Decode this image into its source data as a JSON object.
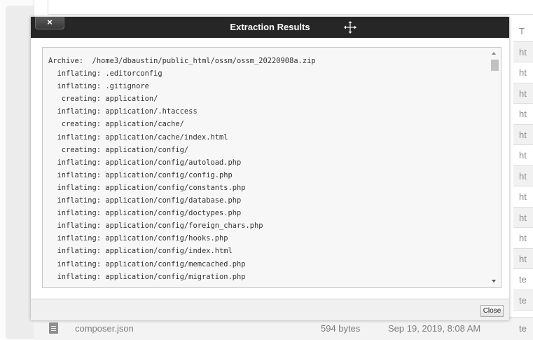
{
  "dialog": {
    "title": "Extraction Results",
    "close_x": "×",
    "close_button": "Close"
  },
  "log_lines": [
    "Archive:  /home3/dbaustin/public_html/ossm/ossm_20220908a.zip",
    "  inflating: .editorconfig",
    "  inflating: .gitignore",
    "   creating: application/",
    "  inflating: application/.htaccess",
    "   creating: application/cache/",
    "  inflating: application/cache/index.html",
    "   creating: application/config/",
    "  inflating: application/config/autoload.php",
    "  inflating: application/config/config.php",
    "  inflating: application/config/constants.php",
    "  inflating: application/config/database.php",
    "  inflating: application/config/doctypes.php",
    "  inflating: application/config/foreign_chars.php",
    "  inflating: application/config/hooks.php",
    "  inflating: application/config/index.html",
    "  inflating: application/config/memcached.php",
    "  inflating: application/config/migration.php"
  ],
  "background": {
    "type_column_cells": [
      "T",
      "ht",
      "ht",
      "ht",
      "ht",
      "ht",
      "ht",
      "ht",
      "ht",
      "ht",
      "ht",
      "ht",
      "te",
      "te"
    ],
    "file_row": {
      "name": "composer.json",
      "size": "594 bytes",
      "modified": "Sep 19, 2019, 8:08 AM",
      "type": "te"
    }
  }
}
